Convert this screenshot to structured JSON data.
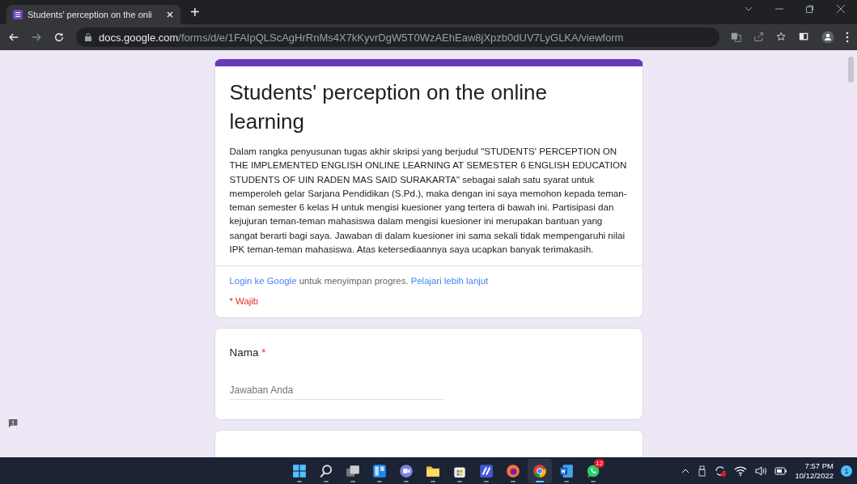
{
  "browser": {
    "tab": {
      "title": "Students' perception on the onli",
      "selected": true
    },
    "new_tab": "+",
    "url": {
      "domain": "docs.google.com",
      "path": "/forms/d/e/1FAIpQLScAgHrRnMs4X7kKyvrDgW5T0WzAEhEaw8jXpzb0dUV7LyGLKA/viewform"
    }
  },
  "form": {
    "title": "Students' perception on the online learning",
    "description": "Dalam rangka penyusunan tugas akhir skripsi yang berjudul \"STUDENTS' PERCEPTION ON THE IMPLEMENTED ENGLISH ONLINE LEARNING  AT SEMESTER 6 ENGLISH EDUCATION STUDENTS OF UIN RADEN MAS SAID SURAKARTA\" sebagai salah satu syarat untuk memperoleh gelar Sarjana Pendidikan (S.Pd.), maka dengan ini saya memohon kepada teman-teman semester 6 kelas H untuk mengisi kuesioner yang tertera di bawah ini. Partisipasi dan kejujuran teman-teman mahasiswa dalam mengisi kuesioner ini merupakan bantuan yang sangat berarti bagi saya. Jawaban di dalam kuesioner ini sama sekali tidak mempengaruhi nilai IPK teman-teman mahasiswa. Atas ketersediaannya saya ucapkan banyak terimakasih.",
    "login_link": "Login ke Google",
    "login_text": "untuk menyimpan progres.",
    "learn_more_link": "Pelajari lebih lanjut",
    "required_note": "* Wajib",
    "questions": [
      {
        "label": "Nama",
        "required_mark": "*",
        "placeholder": "Jawaban Anda"
      }
    ]
  },
  "taskbar": {
    "apps": [
      {
        "kind": "start",
        "selected": false
      },
      {
        "kind": "search",
        "selected": false
      },
      {
        "kind": "taskview",
        "selected": false
      },
      {
        "kind": "widgets",
        "selected": false
      },
      {
        "kind": "chat",
        "selected": false
      },
      {
        "kind": "files",
        "selected": false
      },
      {
        "kind": "store",
        "selected": false
      },
      {
        "kind": "app",
        "selected": false
      },
      {
        "kind": "firefox",
        "selected": false
      },
      {
        "kind": "chrome",
        "selected": true
      },
      {
        "kind": "word",
        "selected": false
      },
      {
        "kind": "whatsapp",
        "selected": false,
        "badge": "12"
      }
    ],
    "time": "7:57 PM",
    "date": "10/12/2022",
    "notifications": "1"
  }
}
